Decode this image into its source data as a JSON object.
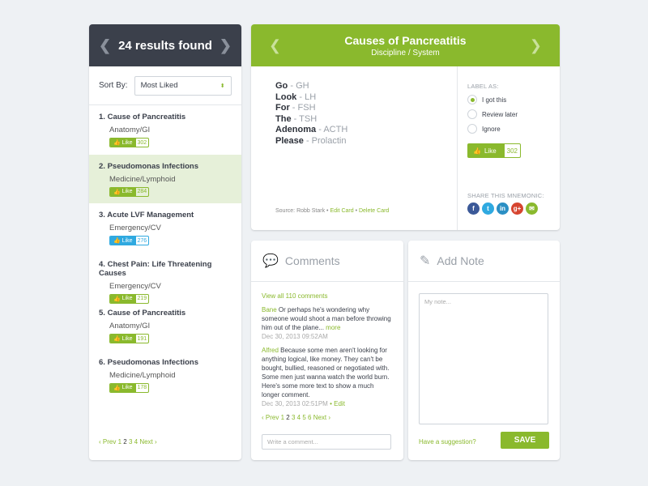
{
  "results": {
    "title": "24 results found",
    "sort_label": "Sort By:",
    "sort_value": "Most Liked",
    "items": [
      {
        "num": "1.",
        "title": "Cause of Pancreatitis",
        "category": "Anatomy/GI",
        "like": "Like",
        "count": "302"
      },
      {
        "num": "2.",
        "title": "Pseudomonas Infections",
        "category": "Medicine/Lymphoid",
        "like": "Like",
        "count": "284"
      },
      {
        "num": "3.",
        "title": "Acute LVF Management",
        "category": "Emergency/CV",
        "like": "Like",
        "count": "276"
      },
      {
        "num": "4.",
        "title": "Chest Pain: Life Threatening Causes",
        "category": "Emergency/CV",
        "like": "Like",
        "count": "219"
      },
      {
        "num": "5.",
        "title": "Cause of Pancreatitis",
        "category": "Anatomy/GI",
        "like": "Like",
        "count": "191"
      },
      {
        "num": "6.",
        "title": "Pseudomonas Infections",
        "category": "Medicine/Lymphoid",
        "like": "Like",
        "count": "178"
      }
    ],
    "pagination": {
      "prev": "‹ Prev",
      "pages": [
        "1",
        "2",
        "3",
        "4"
      ],
      "current": "2",
      "next": "Next ›"
    }
  },
  "card": {
    "title": "Causes of Pancreatitis",
    "subtitle": "Discipline / System",
    "mnemonic": [
      {
        "w": "Go",
        "v": "GH"
      },
      {
        "w": "Look",
        "v": "LH"
      },
      {
        "w": "For",
        "v": "FSH"
      },
      {
        "w": "The",
        "v": "TSH"
      },
      {
        "w": "Adenoma",
        "v": "ACTH"
      },
      {
        "w": "Please",
        "v": "Prolactin"
      }
    ],
    "source": "Source: Robb Stark",
    "edit": "Edit Card",
    "delete": "Delete Card",
    "label_as": "LABEL AS:",
    "options": [
      "I got this",
      "Review later",
      "Ignore"
    ],
    "selected": "I got this",
    "like": "Like",
    "like_count": "302",
    "share_label": "SHARE THIS MNEMONIC:",
    "share_icons": [
      "facebook-icon",
      "twitter-icon",
      "linkedin-icon",
      "google-plus-icon",
      "email-icon"
    ]
  },
  "comments": {
    "title": "Comments",
    "view_all": "View all 110 comments",
    "list": [
      {
        "author": "Bane",
        "text": "Or perhaps he's wondering why someone would shoot a man before throwing him out of the plane...",
        "more": "more",
        "time": "Dec 30, 2013 09:52AM"
      },
      {
        "author": "Alfred",
        "text": "Because some men aren't looking for anything logical, like money. They can't be bought, bullied, reasoned or negotiated with. Some men just wanna watch the world burn. Here's some more text to show a much longer comment.",
        "time": "Dec 30, 2013 02:51PM",
        "edit": "Edit"
      }
    ],
    "pagination": {
      "prev": "‹ Prev",
      "pages": [
        "1",
        "2",
        "3",
        "4",
        "5",
        "6"
      ],
      "current": "2",
      "next": "Next ›"
    },
    "placeholder": "Write a comment..."
  },
  "note": {
    "title": "Add Note",
    "placeholder": "My note...",
    "suggestion": "Have a suggestion?",
    "save": "SAVE"
  },
  "colors": {
    "accent": "#8ab92d",
    "dark": "#3b404b",
    "highlight": "#e6f0d9",
    "blue": "#2fa9e0"
  }
}
